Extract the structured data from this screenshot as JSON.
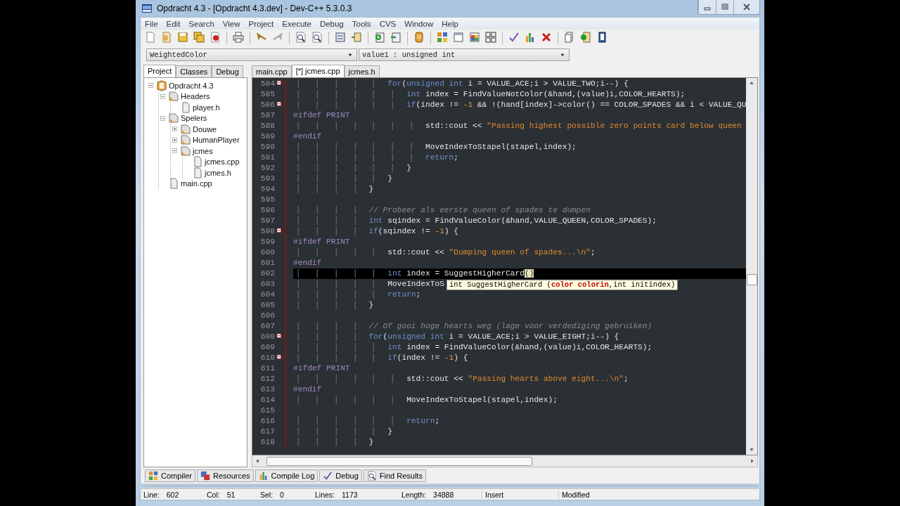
{
  "window": {
    "title": "Opdracht 4.3 - [Opdracht 4.3.dev] - Dev-C++ 5.3.0.3"
  },
  "menu": [
    "File",
    "Edit",
    "Search",
    "View",
    "Project",
    "Execute",
    "Debug",
    "Tools",
    "CVS",
    "Window",
    "Help"
  ],
  "selectors": [
    {
      "value": "WeightedColor"
    },
    {
      "value": "value1 : unsigned int"
    }
  ],
  "sidebar": {
    "tabs": [
      {
        "label": "Project",
        "selected": true
      },
      {
        "label": "Classes",
        "selected": false
      },
      {
        "label": "Debug",
        "selected": false
      }
    ],
    "tree": [
      {
        "label": "Opdracht 4.3",
        "kind": "project",
        "expanded": true,
        "children": [
          {
            "label": "Headers",
            "kind": "folder",
            "expanded": true,
            "children": [
              {
                "label": "player.h",
                "kind": "file"
              }
            ]
          },
          {
            "label": "Spelers",
            "kind": "folder",
            "expanded": true,
            "children": [
              {
                "label": "Douwe",
                "kind": "folder",
                "expanded": false
              },
              {
                "label": "HumanPlayer",
                "kind": "folder",
                "expanded": false
              },
              {
                "label": "jcmes",
                "kind": "folder",
                "expanded": true,
                "children": [
                  {
                    "label": "jcmes.cpp",
                    "kind": "file"
                  },
                  {
                    "label": "jcmes.h",
                    "kind": "file"
                  }
                ]
              }
            ]
          },
          {
            "label": "main.cpp",
            "kind": "file"
          }
        ]
      }
    ]
  },
  "editor": {
    "tabs": [
      {
        "label": "main.cpp",
        "selected": false
      },
      {
        "label": "[*] jcmes.cpp",
        "selected": true
      },
      {
        "label": "jcmes.h",
        "selected": false
      }
    ],
    "lines": [
      {
        "number": "584",
        "fold": true,
        "current": false,
        "tokens": [
          {
            "kind": "kw",
            "text": "                    for"
          },
          {
            "kind": "plain",
            "text": "("
          },
          {
            "kind": "kw",
            "text": "unsigned int"
          },
          {
            "kind": "plain",
            "text": " i = VALUE_ACE;i > VALUE_TWO;i--) {"
          }
        ]
      },
      {
        "number": "585",
        "fold": false,
        "current": false,
        "tokens": [
          {
            "kind": "kw",
            "text": "                        int"
          },
          {
            "kind": "plain",
            "text": " index = FindValueNotColor(&hand,(value)i,COLOR_HEARTS);"
          }
        ]
      },
      {
        "number": "586",
        "fold": true,
        "current": false,
        "tokens": [
          {
            "kind": "kw",
            "text": "                        if"
          },
          {
            "kind": "plain",
            "text": "(index != "
          },
          {
            "kind": "num",
            "text": "-1"
          },
          {
            "kind": "plain",
            "text": " && !(hand[index]->color() == COLOR_SPADES && i < VALUE_QU"
          }
        ]
      },
      {
        "number": "587",
        "fold": false,
        "current": false,
        "tokens": [
          {
            "kind": "pp",
            "text": "#ifdef PRINT"
          }
        ]
      },
      {
        "number": "588",
        "fold": false,
        "current": false,
        "tokens": [
          {
            "kind": "plain",
            "text": "                            std::cout << "
          },
          {
            "kind": "str",
            "text": "\"Passing highest possible zero points card below queen"
          }
        ]
      },
      {
        "number": "589",
        "fold": false,
        "current": false,
        "tokens": [
          {
            "kind": "pp",
            "text": "#endif"
          }
        ]
      },
      {
        "number": "590",
        "fold": false,
        "current": false,
        "tokens": [
          {
            "kind": "plain",
            "text": "                            MoveIndexToStapel(stapel,index);"
          }
        ]
      },
      {
        "number": "591",
        "fold": false,
        "current": false,
        "tokens": [
          {
            "kind": "kw",
            "text": "                            return"
          },
          {
            "kind": "plain",
            "text": ";"
          }
        ]
      },
      {
        "number": "592",
        "fold": false,
        "current": false,
        "tokens": [
          {
            "kind": "plain",
            "text": "                        }"
          }
        ]
      },
      {
        "number": "593",
        "fold": false,
        "current": false,
        "tokens": [
          {
            "kind": "plain",
            "text": "                    }"
          }
        ]
      },
      {
        "number": "594",
        "fold": false,
        "current": false,
        "tokens": [
          {
            "kind": "plain",
            "text": "                }"
          }
        ]
      },
      {
        "number": "595",
        "fold": false,
        "current": false
      },
      {
        "number": "596",
        "fold": false,
        "current": false,
        "tokens": [
          {
            "kind": "cmt",
            "text": "                // Probeer als eerste queen of spades te dumpen"
          }
        ]
      },
      {
        "number": "597",
        "fold": false,
        "current": false,
        "tokens": [
          {
            "kind": "kw",
            "text": "                int"
          },
          {
            "kind": "plain",
            "text": " sqindex = FindValueColor(&hand,VALUE_QUEEN,COLOR_SPADES);"
          }
        ]
      },
      {
        "number": "598",
        "fold": true,
        "current": false,
        "tokens": [
          {
            "kind": "kw",
            "text": "                if"
          },
          {
            "kind": "plain",
            "text": "(sqindex != "
          },
          {
            "kind": "num",
            "text": "-1"
          },
          {
            "kind": "plain",
            "text": ") {"
          }
        ]
      },
      {
        "number": "599",
        "fold": false,
        "current": false,
        "tokens": [
          {
            "kind": "pp",
            "text": "#ifdef PRINT"
          }
        ]
      },
      {
        "number": "600",
        "fold": false,
        "current": false,
        "tokens": [
          {
            "kind": "plain",
            "text": "                    std::cout << "
          },
          {
            "kind": "str",
            "text": "\"Dumping queen of spades...\\n\""
          },
          {
            "kind": "plain",
            "text": ";"
          }
        ]
      },
      {
        "number": "601",
        "fold": false,
        "current": false,
        "tokens": [
          {
            "kind": "pp",
            "text": "#endif"
          }
        ]
      },
      {
        "number": "602",
        "fold": false,
        "current": true,
        "tokens": [
          {
            "kind": "kw",
            "text": "                    int"
          },
          {
            "kind": "plain",
            "text": " index = SuggestHigherCard"
          },
          {
            "kind": "match",
            "text": "()"
          }
        ]
      },
      {
        "number": "603",
        "fold": false,
        "current": false,
        "tokens": [
          {
            "kind": "plain",
            "text": "                    MoveIndexToS"
          }
        ],
        "tooltip": [
          {
            "text": "int SuggestHigherCard (",
            "highlight": false
          },
          {
            "text": "color colorin",
            "highlight": true
          },
          {
            "text": ",int initindex)",
            "highlight": false
          }
        ]
      },
      {
        "number": "604",
        "fold": false,
        "current": false,
        "tokens": [
          {
            "kind": "kw",
            "text": "                    return"
          },
          {
            "kind": "plain",
            "text": ";"
          }
        ]
      },
      {
        "number": "605",
        "fold": false,
        "current": false,
        "tokens": [
          {
            "kind": "plain",
            "text": "                }"
          }
        ]
      },
      {
        "number": "606",
        "fold": false,
        "current": false
      },
      {
        "number": "607",
        "fold": false,
        "current": false,
        "tokens": [
          {
            "kind": "cmt",
            "text": "                // Of gooi hoge hearts weg (lage voor verdediging gebruiken)"
          }
        ]
      },
      {
        "number": "608",
        "fold": true,
        "current": false,
        "tokens": [
          {
            "kind": "kw",
            "text": "                for"
          },
          {
            "kind": "plain",
            "text": "("
          },
          {
            "kind": "kw",
            "text": "unsigned int"
          },
          {
            "kind": "plain",
            "text": " i = VALUE_ACE;i > VALUE_EIGHT;i--) {"
          }
        ]
      },
      {
        "number": "609",
        "fold": false,
        "current": false,
        "tokens": [
          {
            "kind": "kw",
            "text": "                    int"
          },
          {
            "kind": "plain",
            "text": " index = FindValueColor(&hand,(value)i,COLOR_HEARTS);"
          }
        ]
      },
      {
        "number": "610",
        "fold": true,
        "current": false,
        "tokens": [
          {
            "kind": "kw",
            "text": "                    if"
          },
          {
            "kind": "plain",
            "text": "(index != "
          },
          {
            "kind": "num",
            "text": "-1"
          },
          {
            "kind": "plain",
            "text": ") {"
          }
        ]
      },
      {
        "number": "611",
        "fold": false,
        "current": false,
        "tokens": [
          {
            "kind": "pp",
            "text": "#ifdef PRINT"
          }
        ]
      },
      {
        "number": "612",
        "fold": false,
        "current": false,
        "tokens": [
          {
            "kind": "plain",
            "text": "                        std::cout << "
          },
          {
            "kind": "str",
            "text": "\"Passing hearts above eight...\\n\""
          },
          {
            "kind": "plain",
            "text": ";"
          }
        ]
      },
      {
        "number": "613",
        "fold": false,
        "current": false,
        "tokens": [
          {
            "kind": "pp",
            "text": "#endif"
          }
        ]
      },
      {
        "number": "614",
        "fold": false,
        "current": false,
        "tokens": [
          {
            "kind": "plain",
            "text": "                        MoveIndexToStapel(stapel,index);"
          }
        ]
      },
      {
        "number": "615",
        "fold": false,
        "current": false
      },
      {
        "number": "616",
        "fold": false,
        "current": false,
        "tokens": [
          {
            "kind": "kw",
            "text": "                        return"
          },
          {
            "kind": "plain",
            "text": ";"
          }
        ]
      },
      {
        "number": "617",
        "fold": false,
        "current": false,
        "tokens": [
          {
            "kind": "plain",
            "text": "                    }"
          }
        ]
      },
      {
        "number": "618",
        "fold": false,
        "current": false,
        "tokens": [
          {
            "kind": "plain",
            "text": "                }"
          }
        ]
      }
    ]
  },
  "bottom_tabs": [
    {
      "label": "Compiler",
      "kind": "compiler"
    },
    {
      "label": "Resources",
      "kind": "resources"
    },
    {
      "label": "Compile Log",
      "kind": "log"
    },
    {
      "label": "Debug",
      "kind": "debug"
    },
    {
      "label": "Find Results",
      "kind": "find"
    }
  ],
  "status_bar": [
    {
      "label": "Line:",
      "value": "602"
    },
    {
      "label": "Col:",
      "value": "51"
    },
    {
      "label": "Sel:",
      "value": "0"
    },
    {
      "label": "Lines:",
      "value": "1173"
    },
    {
      "label": "Length:",
      "value": "34888"
    },
    {
      "value": "Insert"
    },
    {
      "value": "Modified"
    }
  ]
}
